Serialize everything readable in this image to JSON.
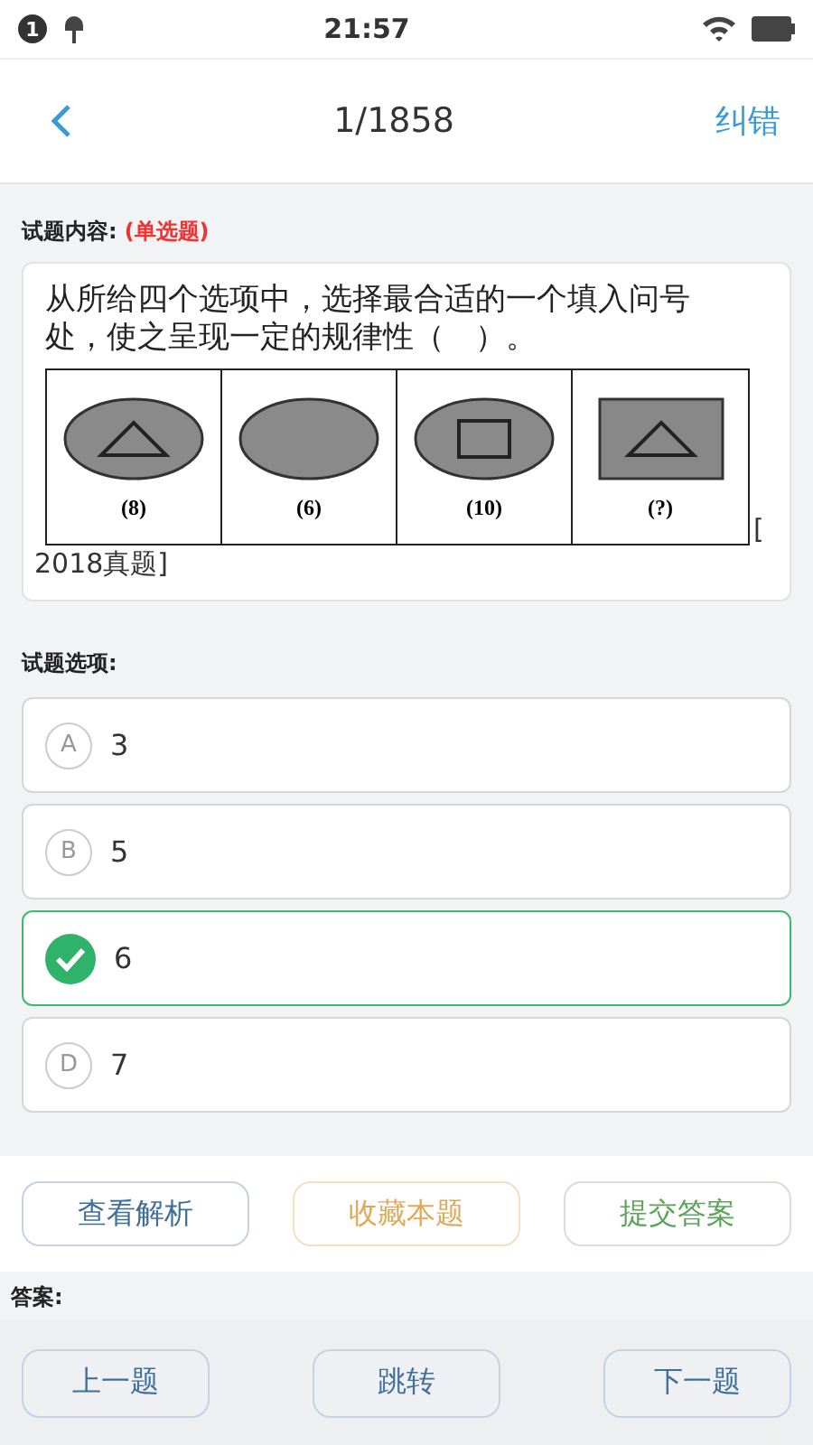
{
  "status_bar": {
    "notification_count": "1",
    "time": "21:57"
  },
  "header": {
    "title": "1/1858",
    "action": "纠错"
  },
  "question": {
    "label": "试题内容:",
    "type_tag": "(单选题)",
    "text": "从所给四个选项中，选择最合适的一个填入问号处，使之呈现一定的规律性（　）。",
    "figure": [
      {
        "kind": "ellipse_triangle",
        "caption": "(8)"
      },
      {
        "kind": "ellipse",
        "caption": "(6)"
      },
      {
        "kind": "ellipse_square",
        "caption": "(10)"
      },
      {
        "kind": "square_triangle",
        "caption": "(?)"
      }
    ],
    "source_start": "[",
    "source_end": "2018真题]"
  },
  "options_label": "试题选项:",
  "options": [
    {
      "letter": "A",
      "text": "3",
      "selected": false
    },
    {
      "letter": "B",
      "text": "5",
      "selected": false
    },
    {
      "text": "6",
      "selected": true
    },
    {
      "letter": "D",
      "text": "7",
      "selected": false
    }
  ],
  "actions": [
    {
      "label": "查看解析",
      "kind": "analysis"
    },
    {
      "label": "收藏本题",
      "kind": "favorite"
    },
    {
      "label": "提交答案",
      "kind": "submit"
    }
  ],
  "answer_label": "答案:",
  "nav": [
    {
      "label": "上一题"
    },
    {
      "label": "跳转"
    },
    {
      "label": "下一题"
    }
  ]
}
